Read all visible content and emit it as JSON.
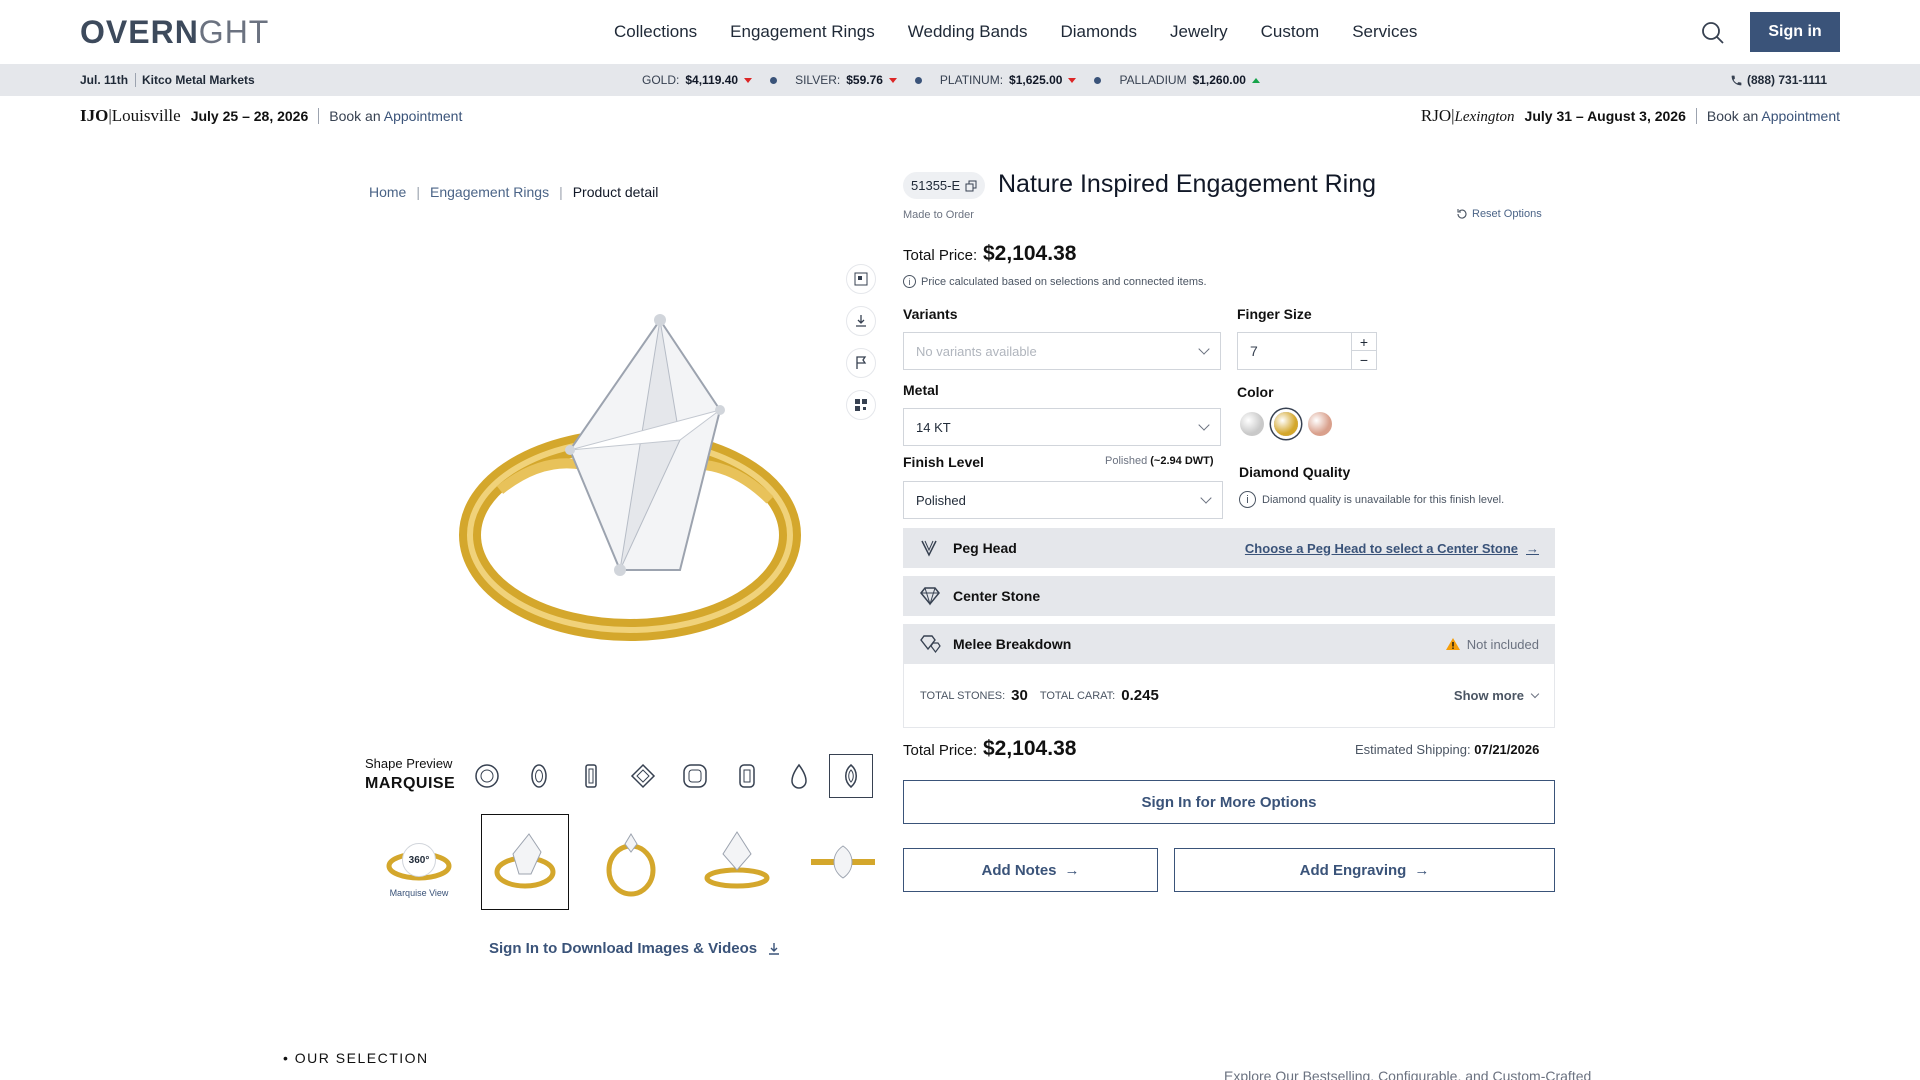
{
  "brand": {
    "logo_main": "OVERN",
    "logo_rest": "GHT"
  },
  "nav": [
    "Collections",
    "Engagement Rings",
    "Wedding Bands",
    "Diamonds",
    "Jewelry",
    "Custom",
    "Services"
  ],
  "header": {
    "signin_label": "Sign in"
  },
  "ticker": {
    "date": "Jul. 11th",
    "source": "Kitco Metal Markets",
    "metals": [
      {
        "label": "GOLD:",
        "value": "$4,119.40",
        "trend": "down"
      },
      {
        "label": "SILVER:",
        "value": "$59.76",
        "trend": "down"
      },
      {
        "label": "PLATINUM:",
        "value": "$1,625.00",
        "trend": "down"
      },
      {
        "label": "PALLADIUM",
        "value": "$1,260.00",
        "trend": "up"
      }
    ],
    "phone": "(888) 731-1111"
  },
  "events": {
    "left": {
      "brand": "IJO",
      "city": "Louisville",
      "dates": "July 25 – 28, 2026",
      "book": "Book an",
      "link": "Appointment"
    },
    "right": {
      "brand": "RJO",
      "city": "Lexington",
      "dates": "July 31 – August 3, 2026",
      "book": "Book an",
      "link": "Appointment"
    }
  },
  "breadcrumb": [
    "Home",
    "Engagement Rings",
    "Product detail"
  ],
  "gallery": {
    "shape_preview_label": "Shape Preview",
    "shape_selected": "MARQUISE",
    "shapes": [
      "round-icon",
      "oval-icon",
      "emerald-icon",
      "princess-icon",
      "cushion-icon",
      "radiant-icon",
      "pear-icon",
      "marquise-icon"
    ],
    "thumb_360_badge": "360°",
    "thumb_360_caption": "Marquise View",
    "download_label": "Sign In to Download Images & Videos"
  },
  "product": {
    "sku": "51355-E",
    "title": "Nature Inspired Engagement Ring",
    "availability": "Made to Order",
    "reset_label": "Reset Options",
    "total_price_label": "Total Price:",
    "total_price": "$2,104.38",
    "price_note": "Price calculated based on selections and connected items."
  },
  "options": {
    "variants_label": "Variants",
    "variants_placeholder": "No variants available",
    "finger_label": "Finger Size",
    "finger_value": "7",
    "metal_label": "Metal",
    "metal_value": "14 KT",
    "color_label": "Color",
    "colors": [
      "#c9c9c9",
      "#d4a72c",
      "#d9a08c"
    ],
    "finish_label": "Finish Level",
    "finish_note_a": "Polished",
    "finish_note_b": "(~2.94 DWT)",
    "finish_value": "Polished",
    "dq_label": "Diamond Quality",
    "dq_note": "Diamond quality is unavailable for this finish level."
  },
  "sections": {
    "peg_head": "Peg Head",
    "peg_head_link": "Choose a Peg Head to select a Center Stone",
    "center_stone": "Center Stone",
    "melee": "Melee Breakdown",
    "melee_status": "Not included",
    "total_stones_label": "TOTAL STONES:",
    "total_stones": "30",
    "total_carat_label": "TOTAL CARAT:",
    "total_carat": "0.245",
    "show_more": "Show more"
  },
  "footer_price": {
    "label": "Total Price:",
    "value": "$2,104.38",
    "ship_label": "Estimated Shipping:",
    "ship_date": "07/21/2026"
  },
  "actions": {
    "sign_in_more": "Sign In for More Options",
    "add_notes": "Add Notes",
    "add_engraving": "Add Engraving"
  },
  "below": {
    "section_title": "• OUR SELECTION",
    "explore": "Explore Our Bestselling, Configurable, and Custom-Crafted"
  },
  "colors": {
    "accent": "#3a5379",
    "bar": "#e5e7eb",
    "gold": "#d4a72c"
  }
}
